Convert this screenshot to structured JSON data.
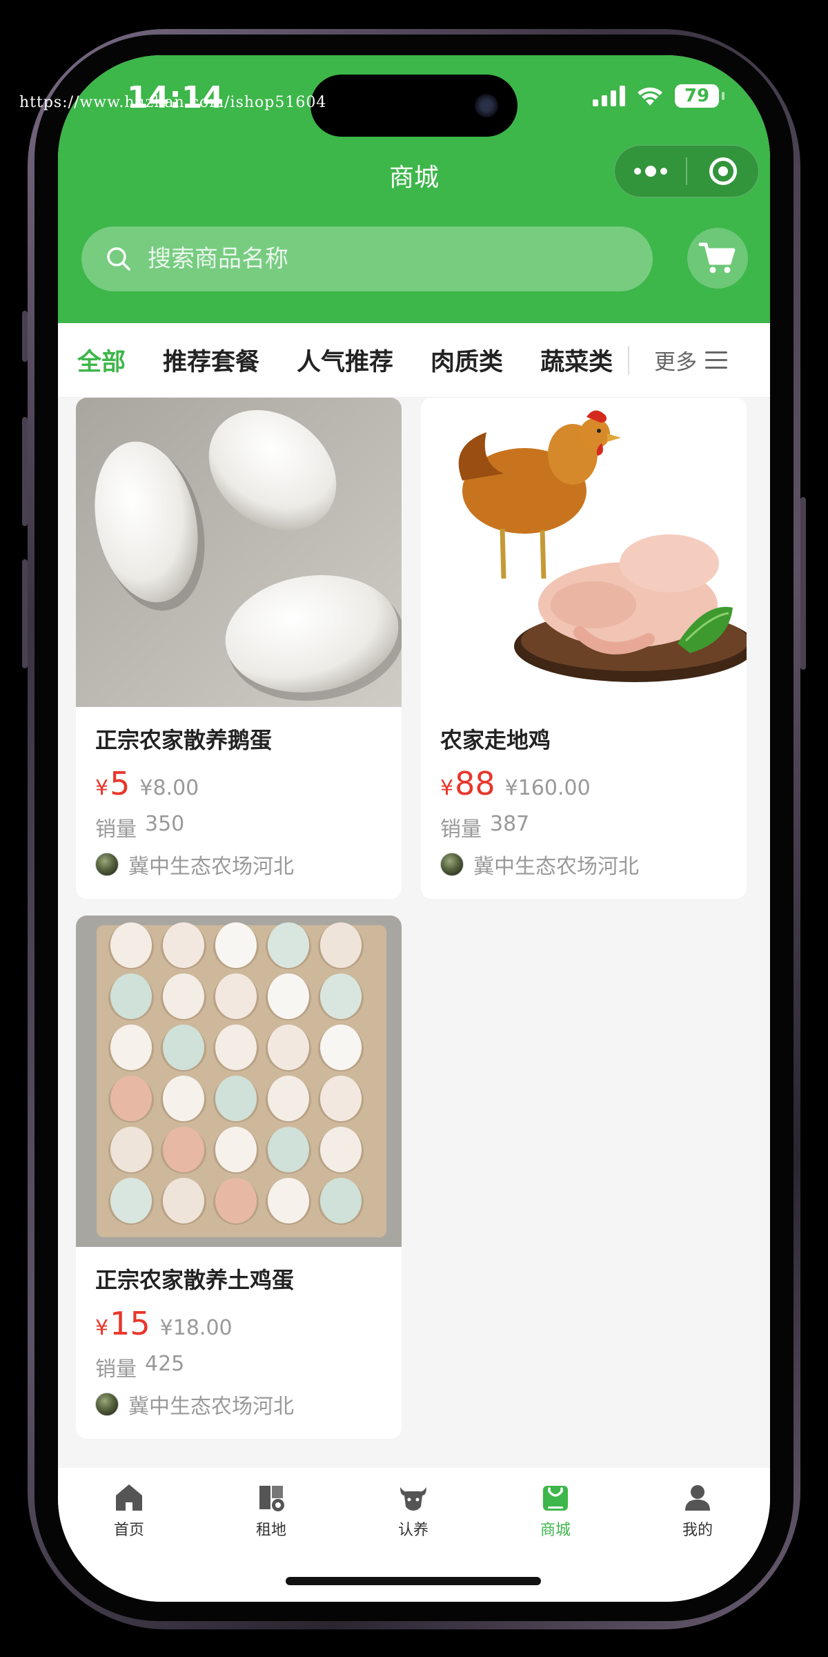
{
  "status_bar": {
    "time": "14:14",
    "battery": "79"
  },
  "watermark": "https://www.huzhan.com/ishop51604",
  "nav": {
    "title": "商城"
  },
  "search": {
    "placeholder": "搜索商品名称"
  },
  "categories": {
    "tabs": [
      "全部",
      "推荐套餐",
      "人气推荐",
      "肉质类",
      "蔬菜类"
    ],
    "active": "全部",
    "more_label": "更多"
  },
  "products": [
    {
      "name": "正宗农家散养鹅蛋",
      "currency": "¥",
      "price": "5",
      "original_price": "¥8.00",
      "sales_label": "销量",
      "sales": "350",
      "farm": "冀中生态农场河北"
    },
    {
      "name": "农家走地鸡",
      "currency": "¥",
      "price": "88",
      "original_price": "¥160.00",
      "sales_label": "销量",
      "sales": "387",
      "farm": "冀中生态农场河北"
    },
    {
      "name": "正宗农家散养土鸡蛋",
      "currency": "¥",
      "price": "15",
      "original_price": "¥18.00",
      "sales_label": "销量",
      "sales": "425",
      "farm": "冀中生态农场河北"
    }
  ],
  "tabbar": {
    "items": [
      {
        "label": "首页",
        "icon": "home-icon"
      },
      {
        "label": "租地",
        "icon": "land-icon"
      },
      {
        "label": "认养",
        "icon": "cow-icon"
      },
      {
        "label": "商城",
        "icon": "shop-bag-icon"
      },
      {
        "label": "我的",
        "icon": "user-icon"
      }
    ],
    "active": "商城"
  },
  "colors": {
    "brand_green": "#3db64a",
    "price_red": "#e8362b",
    "muted": "#999999"
  }
}
